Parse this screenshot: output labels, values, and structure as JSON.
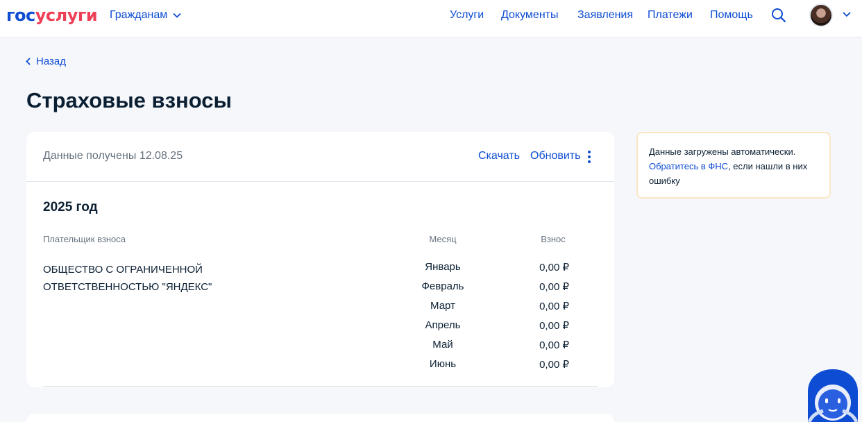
{
  "header": {
    "logo_part1": "гос",
    "logo_part2": "услуги",
    "citizens": "Гражданам",
    "nav": [
      "Услуги",
      "Документы",
      "Заявления",
      "Платежи",
      "Помощь"
    ]
  },
  "back": "Назад",
  "title": "Страховые взносы",
  "card": {
    "received": "Данные получены 12.08.25",
    "download": "Скачать",
    "refresh": "Обновить",
    "year": "2025 год",
    "columns": {
      "payer": "Плательщик взноса",
      "month": "Месяц",
      "amount": "Взнос"
    },
    "payer": "ОБЩЕСТВО С ОГРАНИЧЕННОЙ ОТВЕТСТВЕННОСТЬЮ \"ЯНДЕКС\"",
    "rows": [
      {
        "month": "Январь",
        "amount": "0,00 ₽"
      },
      {
        "month": "Февраль",
        "amount": "0,00 ₽"
      },
      {
        "month": "Март",
        "amount": "0,00 ₽"
      },
      {
        "month": "Апрель",
        "amount": "0,00 ₽"
      },
      {
        "month": "Май",
        "amount": "0,00 ₽"
      },
      {
        "month": "Июнь",
        "amount": "0,00 ₽"
      }
    ]
  },
  "info": {
    "text1": "Данные загружены автоматически.",
    "link": "Обратитесь в ФНС",
    "text2": ", если нашли в них ошибку"
  },
  "colors": {
    "primary": "#0d4cd3",
    "brand_red": "#ee3f58",
    "info_border": "#fbe6c5"
  }
}
